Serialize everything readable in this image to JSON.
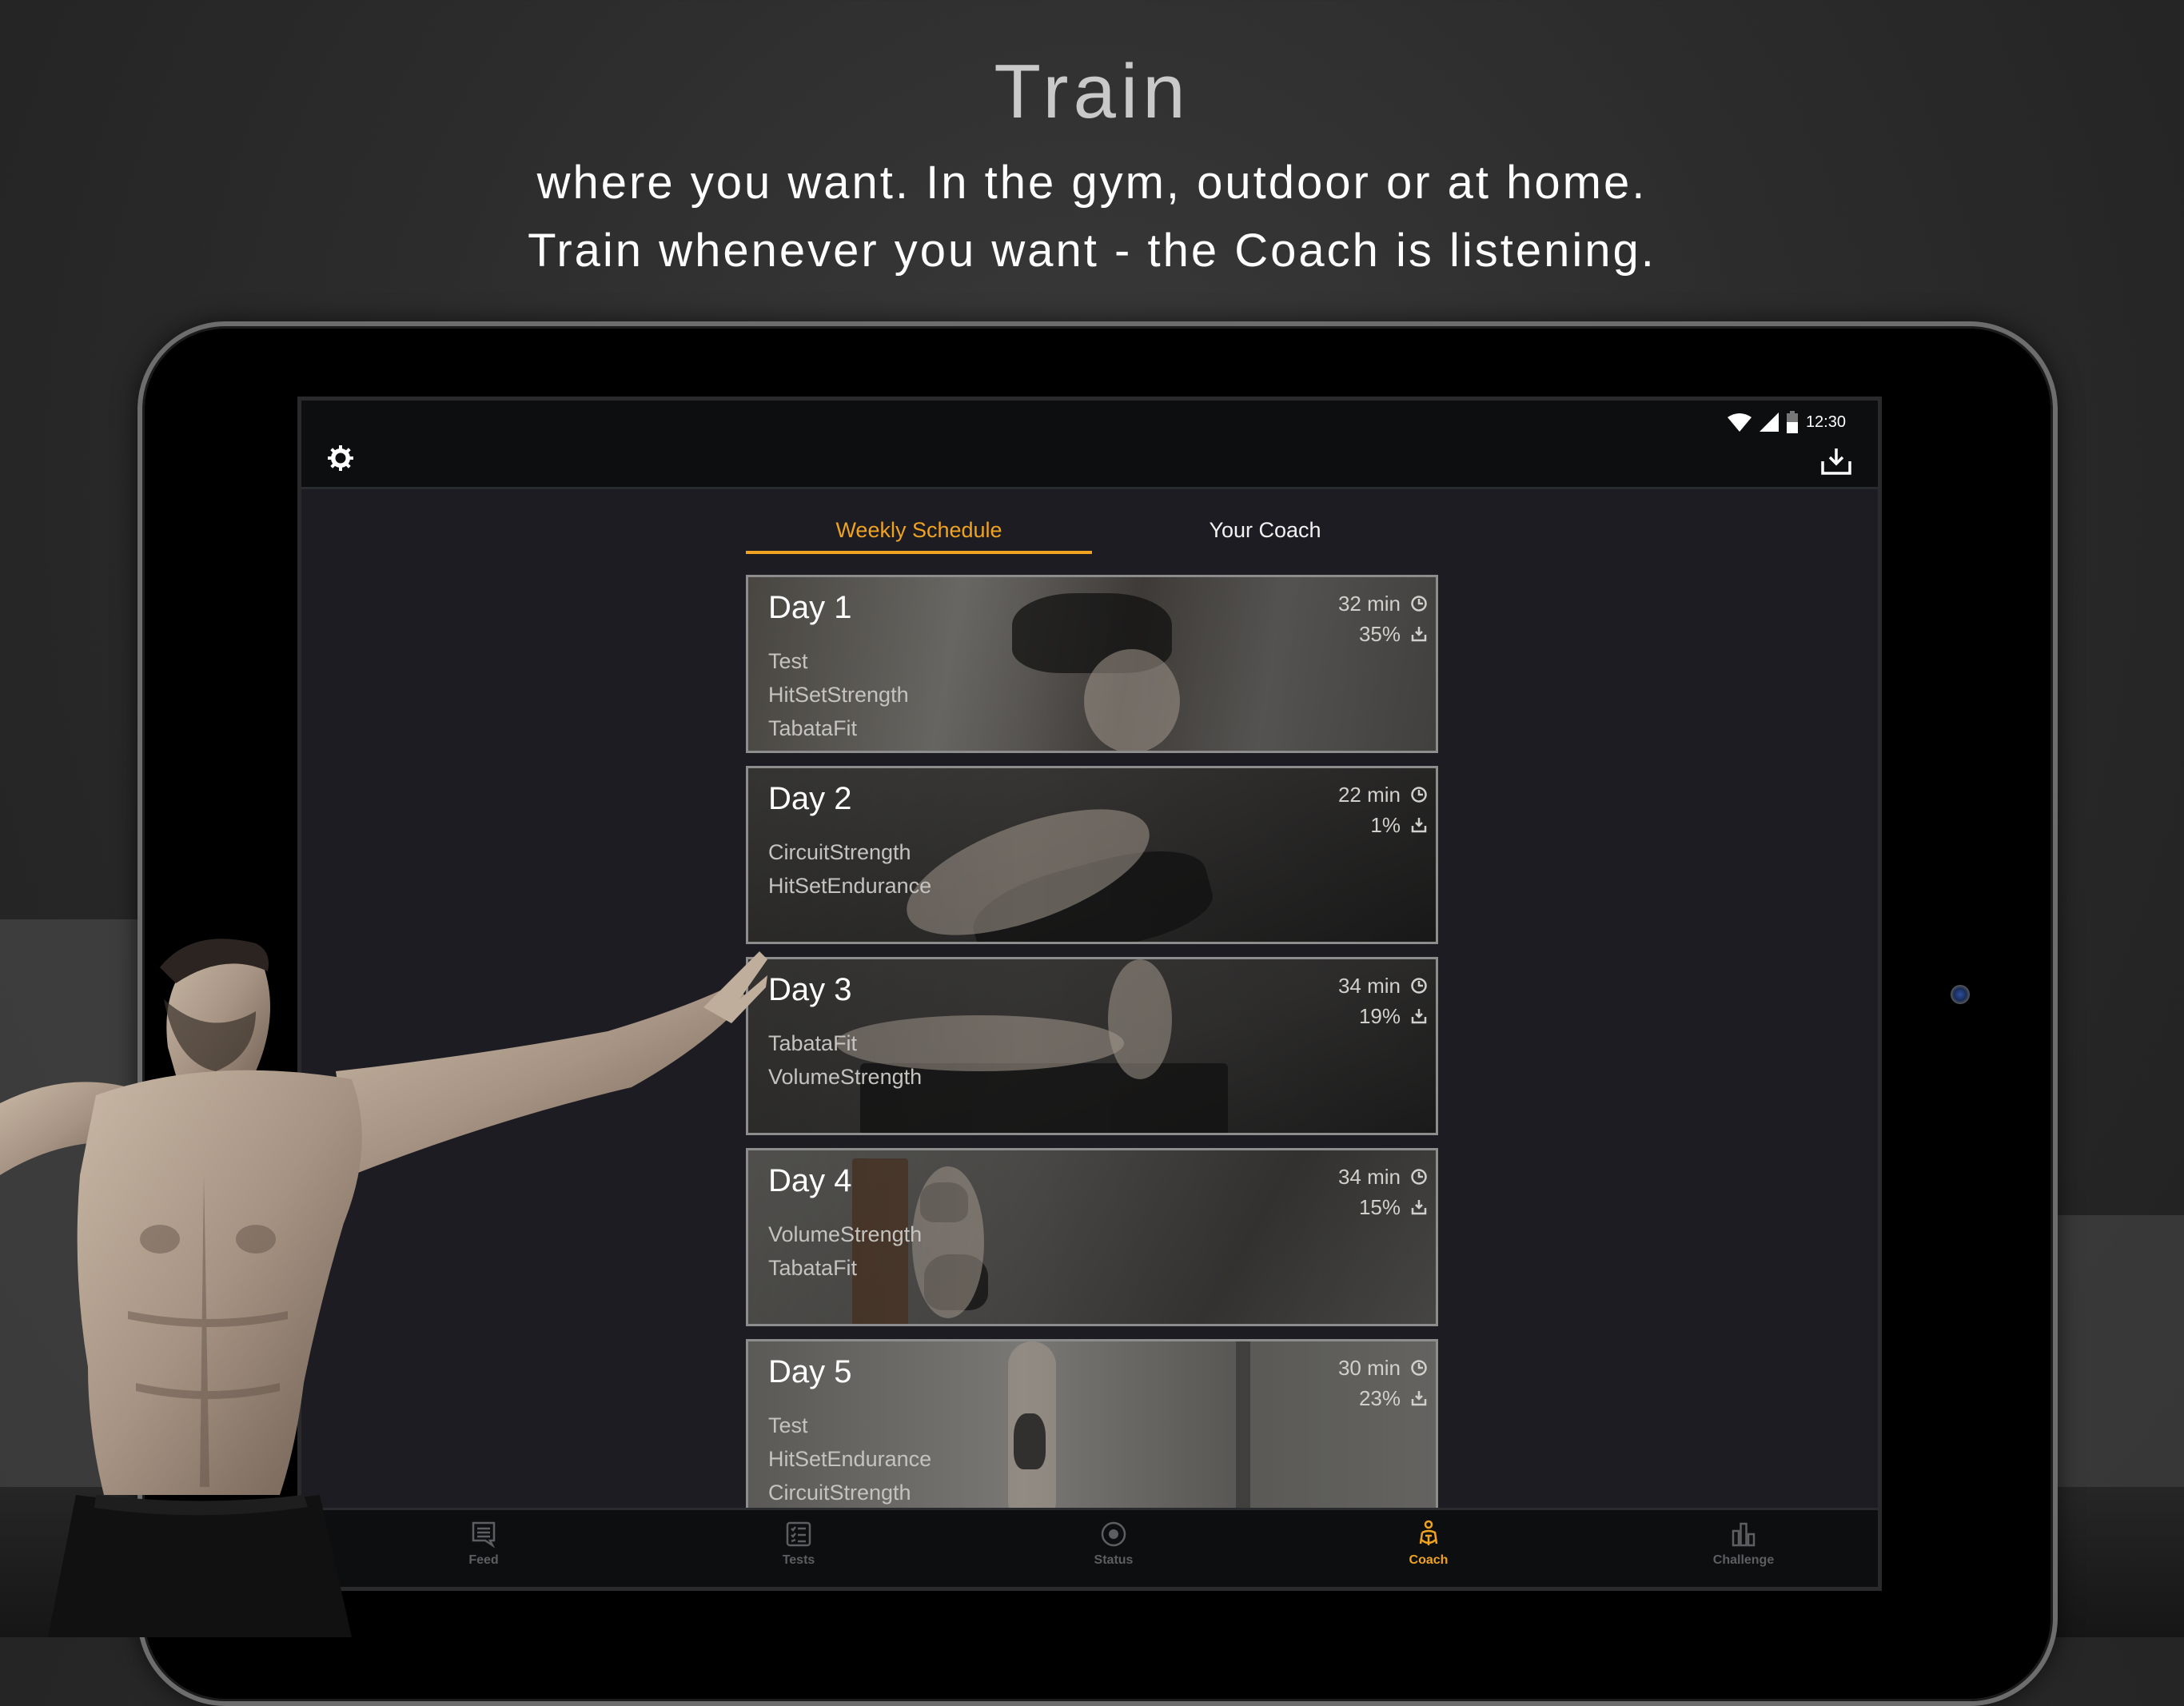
{
  "promo": {
    "headline": "Train",
    "line1": "where you want. In the gym, outdoor or at home.",
    "line2": "Train whenever you want - the Coach is listening."
  },
  "status_bar": {
    "time": "12:30",
    "icons": [
      "wifi-icon",
      "cellular-signal-icon",
      "battery-icon"
    ]
  },
  "toolbar": {
    "settings_icon": "gear-icon",
    "download_icon": "download-icon"
  },
  "tabs": [
    {
      "label": "Weekly Schedule",
      "active": true
    },
    {
      "label": "Your Coach",
      "active": false
    }
  ],
  "schedule": [
    {
      "day": "Day 1",
      "workouts": [
        "Test",
        "HitSetStrength",
        "TabataFit"
      ],
      "duration": "32 min",
      "downloaded": "35%"
    },
    {
      "day": "Day 2",
      "workouts": [
        "CircuitStrength",
        "HitSetEndurance"
      ],
      "duration": "22 min",
      "downloaded": "1%"
    },
    {
      "day": "Day 3",
      "workouts": [
        "TabataFit",
        "VolumeStrength"
      ],
      "duration": "34 min",
      "downloaded": "19%"
    },
    {
      "day": "Day 4",
      "workouts": [
        "VolumeStrength",
        "TabataFit"
      ],
      "duration": "34 min",
      "downloaded": "15%"
    },
    {
      "day": "Day 5",
      "workouts": [
        "Test",
        "HitSetEndurance",
        "CircuitStrength"
      ],
      "duration": "30 min",
      "downloaded": "23%"
    }
  ],
  "bottom_nav": [
    {
      "label": "Feed",
      "icon": "feed-icon",
      "active": false
    },
    {
      "label": "Tests",
      "icon": "checklist-icon",
      "active": false
    },
    {
      "label": "Status",
      "icon": "status-icon",
      "active": false
    },
    {
      "label": "Coach",
      "icon": "coach-icon",
      "active": true
    },
    {
      "label": "Challenge",
      "icon": "bar-chart-icon",
      "active": false
    }
  ],
  "colors": {
    "accent": "#f0a31f",
    "screen_bg": "#1c1c22",
    "bar_bg": "#0d0e10",
    "inactive_nav": "#5d5e61"
  }
}
